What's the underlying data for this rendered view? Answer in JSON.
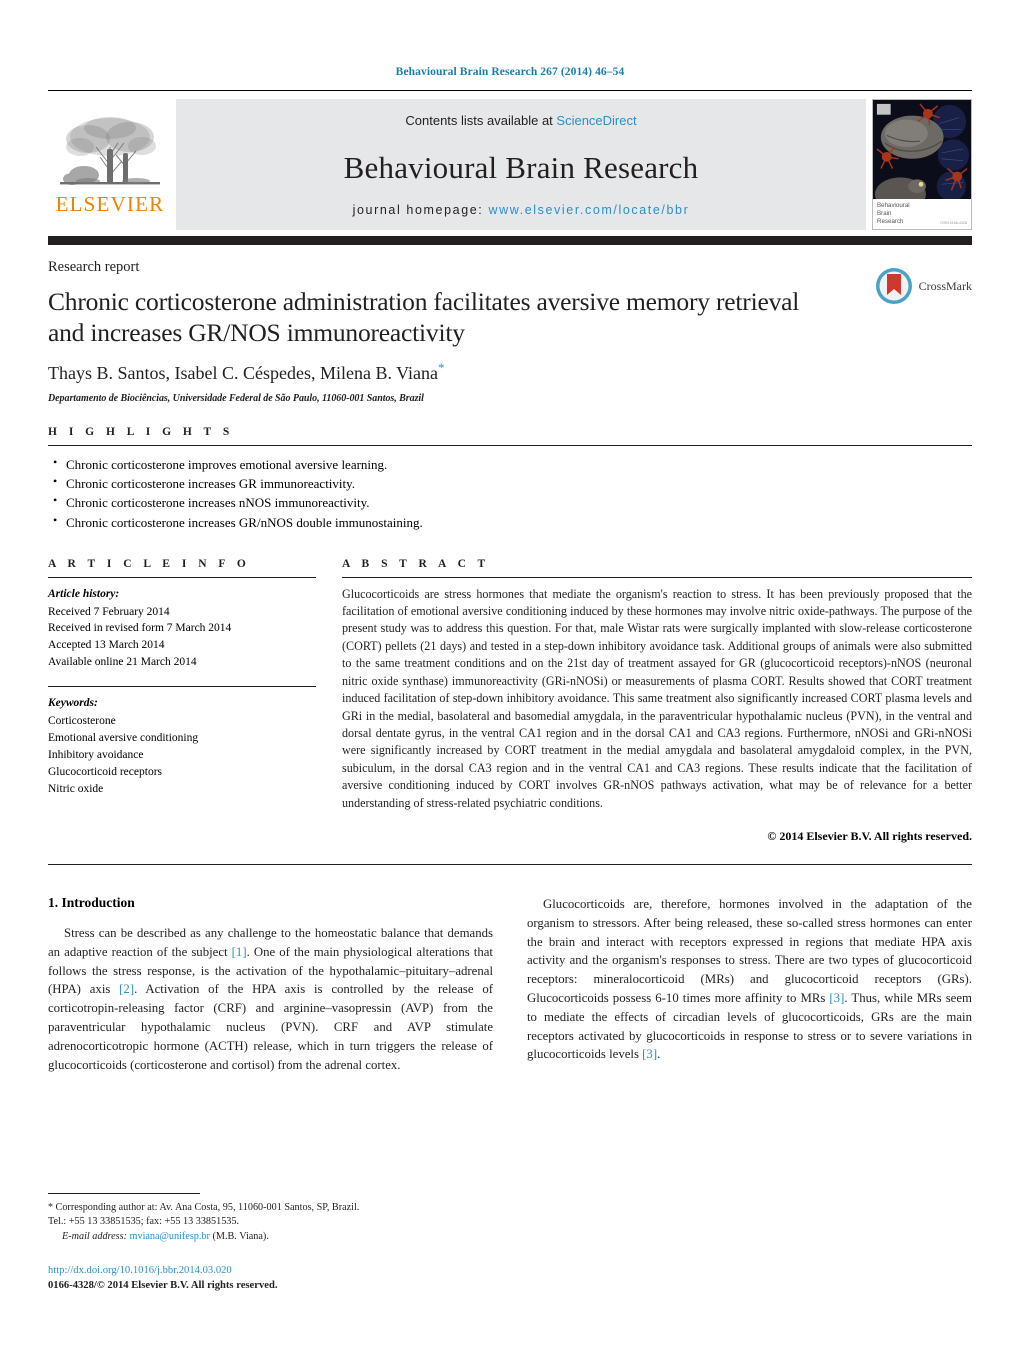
{
  "running_head": "Behavioural Brain Research 267 (2014) 46–54",
  "masthead": {
    "contents_prefix": "Contents lists available at ",
    "sciencedirect": "ScienceDirect",
    "journal_name": "Behavioural Brain Research",
    "homepage_label": "journal homepage:",
    "homepage_url": "www.elsevier.com/locate/bbr",
    "publisher_wordmark": "ELSEVIER",
    "publisher_color": "#ef8200",
    "link_color": "#2b8fc6",
    "box_bg": "#e6e7e8",
    "cover_caption_line1": "Behavioural",
    "cover_caption_line2": "Brain",
    "cover_caption_line3": "Research",
    "cover_issn": "ISSN 0166-4328"
  },
  "article": {
    "doc_type": "Research report",
    "title": "Chronic corticosterone administration facilitates aversive memory retrieval and increases GR/NOS immunoreactivity",
    "authors": "Thays B. Santos, Isabel C. Céspedes, Milena B. Viana",
    "corresponding_marker": "*",
    "affiliation": "Departamento de Biociências, Universidade Federal de São Paulo, 11060-001 Santos, Brazil",
    "crossmark_label": "CrossMark"
  },
  "highlights": {
    "label": "H I G H L I G H T S",
    "items": [
      "Chronic corticosterone improves emotional aversive learning.",
      "Chronic corticosterone increases GR immunoreactivity.",
      "Chronic corticosterone increases nNOS immunoreactivity.",
      "Chronic corticosterone increases GR/nNOS double immunostaining."
    ]
  },
  "article_info": {
    "label": "A R T I C L E   I N F O",
    "history_head": "Article history:",
    "history": [
      "Received 7 February 2014",
      "Received in revised form 7 March 2014",
      "Accepted 13 March 2014",
      "Available online 21 March 2014"
    ],
    "keywords_head": "Keywords:",
    "keywords": [
      "Corticosterone",
      "Emotional aversive conditioning",
      "Inhibitory avoidance",
      "Glucocorticoid receptors",
      "Nitric oxide"
    ]
  },
  "abstract": {
    "label": "A B S T R A C T",
    "text": "Glucocorticoids are stress hormones that mediate the organism's reaction to stress. It has been previously proposed that the facilitation of emotional aversive conditioning induced by these hormones may involve nitric oxide-pathways. The purpose of the present study was to address this question. For that, male Wistar rats were surgically implanted with slow-release corticosterone (CORT) pellets (21 days) and tested in a step-down inhibitory avoidance task. Additional groups of animals were also submitted to the same treatment conditions and on the 21st day of treatment assayed for GR (glucocorticoid receptors)-nNOS (neuronal nitric oxide synthase) immunoreactivity (GRi-nNOSi) or measurements of plasma CORT. Results showed that CORT treatment induced facilitation of step-down inhibitory avoidance. This same treatment also significantly increased CORT plasma levels and GRi in the medial, basolateral and basomedial amygdala, in the paraventricular hypothalamic nucleus (PVN), in the ventral and dorsal dentate gyrus, in the ventral CA1 region and in the dorsal CA1 and CA3 regions. Furthermore, nNOSi and GRi-nNOSi were significantly increased by CORT treatment in the medial amygdala and basolateral amygdaloid complex, in the PVN, subiculum, in the dorsal CA3 region and in the ventral CA1 and CA3 regions. These results indicate that the facilitation of aversive conditioning induced by CORT involves GR-nNOS pathways activation, what may be of relevance for a better understanding of stress-related psychiatric conditions.",
    "copyright": "© 2014 Elsevier B.V. All rights reserved."
  },
  "introduction": {
    "heading": "1.  Introduction",
    "para1_a": "Stress can be described as any challenge to the homeostatic balance that demands an adaptive reaction of the subject ",
    "para1_ref1": "[1]",
    "para1_b": ". One of the main physiological alterations that follows the stress response, is the activation of the hypothalamic–pituitary–adrenal (HPA) axis ",
    "para1_ref2": "[2]",
    "para1_c": ". Activation of the HPA axis is controlled by the release of corticotropin-releasing factor (CRF) and arginine–vasopressin (AVP) from the paraventricular hypothalamic nucleus (PVN). CRF and AVP stimulate adrenocorticotropic hormone (ACTH) release, which in turn triggers the release of glucocorticoids (corticosterone and cortisol) from the adrenal cortex.",
    "para2_a": "Glucocorticoids are, therefore, hormones involved in the adaptation of the organism to stressors. After being released, these so-called stress hormones can enter the brain and interact with receptors expressed in regions that mediate HPA axis activity and the organism's responses to stress. There are two types of glucocorticoid receptors: mineralocorticoid (MRs) and glucocorticoid receptors (GRs). Glucocorticoids possess 6-10 times more affinity to MRs ",
    "para2_ref1": "[3]",
    "para2_b": ". Thus, while MRs seem to mediate the effects of circadian levels of glucocorticoids, GRs are the main receptors activated by glucocorticoids in response to stress or to severe variations in glucocorticoids levels ",
    "para2_ref2": "[3]",
    "para2_c": "."
  },
  "footnote": {
    "star": "*",
    "corresponding": "Corresponding author at: Av. Ana Costa, 95, 11060-001 Santos, SP, Brazil.",
    "tel": "Tel.: +55 13 33851535; fax: +55 13 33851535.",
    "email_label": "E-mail address:",
    "email": "mviana@unifesp.br",
    "email_suffix": "(M.B. Viana).",
    "doi": "http://dx.doi.org/10.1016/j.bbr.2014.03.020",
    "issn_line": "0166-4328/© 2014 Elsevier B.V. All rights reserved."
  }
}
